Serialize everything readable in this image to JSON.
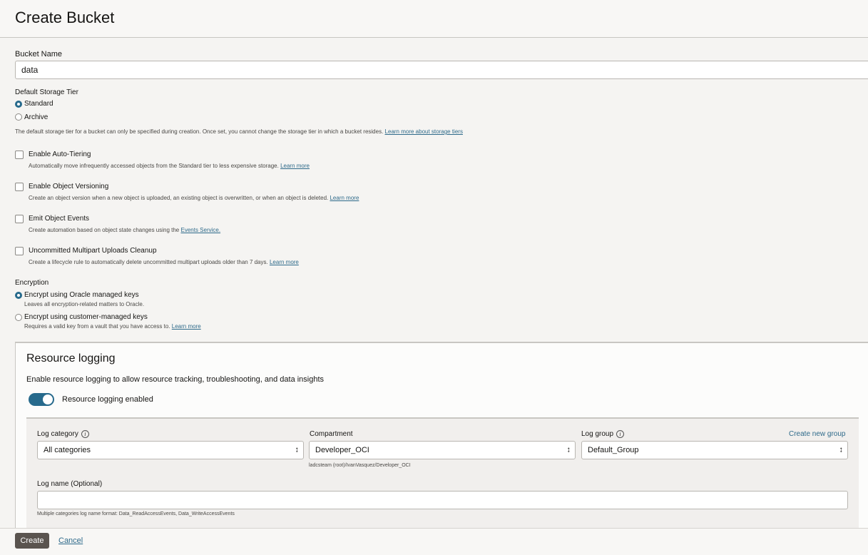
{
  "page_title": "Create Bucket",
  "bucket_name": {
    "label": "Bucket Name",
    "value": "data"
  },
  "storage_tier": {
    "label": "Default Storage Tier",
    "options": [
      "Standard",
      "Archive"
    ],
    "selected": "Standard",
    "help": "The default storage tier for a bucket can only be specified during creation. Once set, you cannot change the storage tier in which a bucket resides.",
    "help_link": "Learn more about storage tiers"
  },
  "options": {
    "auto_tiering": {
      "label": "Enable Auto-Tiering",
      "help": "Automatically move infrequently accessed objects from the Standard tier to less expensive storage.",
      "link": "Learn more"
    },
    "versioning": {
      "label": "Enable Object Versioning",
      "help": "Create an object version when a new object is uploaded, an existing object is overwritten, or when an object is deleted.",
      "link": "Learn more"
    },
    "events": {
      "label": "Emit Object Events",
      "help": "Create automation based on object state changes using the",
      "link": "Events Service."
    },
    "multipart": {
      "label": "Uncommitted Multipart Uploads Cleanup",
      "help": "Create a lifecycle rule to automatically delete uncommitted multipart uploads older than 7 days.",
      "link": "Learn more"
    }
  },
  "encryption": {
    "label": "Encryption",
    "oracle": {
      "label": "Encrypt using Oracle managed keys",
      "help": "Leaves all encryption-related matters to Oracle."
    },
    "customer": {
      "label": "Encrypt using customer-managed keys",
      "help": "Requires a valid key from a vault that you have access to.",
      "link": "Learn more"
    }
  },
  "resource_logging": {
    "title": "Resource logging",
    "description": "Enable resource logging to allow resource tracking, troubleshooting, and data insights",
    "toggle_label": "Resource logging enabled",
    "enabled": true,
    "log_category": {
      "label": "Log category",
      "value": "All categories"
    },
    "compartment": {
      "label": "Compartment",
      "value": "Developer_OCI",
      "path": "ladcsteam (root)/IvanVasquez/Developer_OCI"
    },
    "log_group": {
      "label": "Log group",
      "value": "Default_Group",
      "create_link": "Create new group"
    },
    "log_name": {
      "label": "Log name (Optional)",
      "value": "",
      "help": "Multiple categories log name format: Data_ReadAccessEvents, Data_WriteAccessEvents"
    }
  },
  "footer": {
    "create": "Create",
    "cancel": "Cancel"
  },
  "colors": {
    "accent": "#276a8c",
    "link": "#2e6a8a",
    "primary_button": "#5a544f"
  },
  "icons": {
    "info": "info-icon",
    "select": "chevron-updown-icon"
  }
}
